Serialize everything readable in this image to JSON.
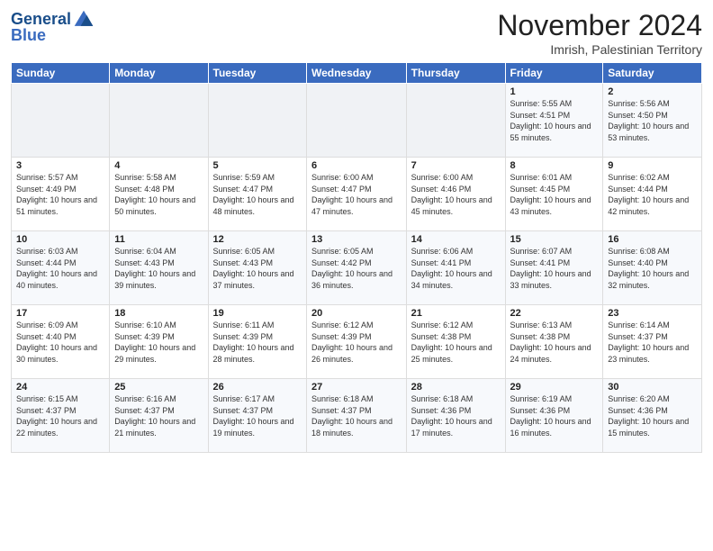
{
  "header": {
    "logo_line1": "General",
    "logo_line2": "Blue",
    "month": "November 2024",
    "location": "Imrish, Palestinian Territory"
  },
  "days_of_week": [
    "Sunday",
    "Monday",
    "Tuesday",
    "Wednesday",
    "Thursday",
    "Friday",
    "Saturday"
  ],
  "weeks": [
    [
      {
        "day": "",
        "info": ""
      },
      {
        "day": "",
        "info": ""
      },
      {
        "day": "",
        "info": ""
      },
      {
        "day": "",
        "info": ""
      },
      {
        "day": "",
        "info": ""
      },
      {
        "day": "1",
        "info": "Sunrise: 5:55 AM\nSunset: 4:51 PM\nDaylight: 10 hours and 55 minutes."
      },
      {
        "day": "2",
        "info": "Sunrise: 5:56 AM\nSunset: 4:50 PM\nDaylight: 10 hours and 53 minutes."
      }
    ],
    [
      {
        "day": "3",
        "info": "Sunrise: 5:57 AM\nSunset: 4:49 PM\nDaylight: 10 hours and 51 minutes."
      },
      {
        "day": "4",
        "info": "Sunrise: 5:58 AM\nSunset: 4:48 PM\nDaylight: 10 hours and 50 minutes."
      },
      {
        "day": "5",
        "info": "Sunrise: 5:59 AM\nSunset: 4:47 PM\nDaylight: 10 hours and 48 minutes."
      },
      {
        "day": "6",
        "info": "Sunrise: 6:00 AM\nSunset: 4:47 PM\nDaylight: 10 hours and 47 minutes."
      },
      {
        "day": "7",
        "info": "Sunrise: 6:00 AM\nSunset: 4:46 PM\nDaylight: 10 hours and 45 minutes."
      },
      {
        "day": "8",
        "info": "Sunrise: 6:01 AM\nSunset: 4:45 PM\nDaylight: 10 hours and 43 minutes."
      },
      {
        "day": "9",
        "info": "Sunrise: 6:02 AM\nSunset: 4:44 PM\nDaylight: 10 hours and 42 minutes."
      }
    ],
    [
      {
        "day": "10",
        "info": "Sunrise: 6:03 AM\nSunset: 4:44 PM\nDaylight: 10 hours and 40 minutes."
      },
      {
        "day": "11",
        "info": "Sunrise: 6:04 AM\nSunset: 4:43 PM\nDaylight: 10 hours and 39 minutes."
      },
      {
        "day": "12",
        "info": "Sunrise: 6:05 AM\nSunset: 4:43 PM\nDaylight: 10 hours and 37 minutes."
      },
      {
        "day": "13",
        "info": "Sunrise: 6:05 AM\nSunset: 4:42 PM\nDaylight: 10 hours and 36 minutes."
      },
      {
        "day": "14",
        "info": "Sunrise: 6:06 AM\nSunset: 4:41 PM\nDaylight: 10 hours and 34 minutes."
      },
      {
        "day": "15",
        "info": "Sunrise: 6:07 AM\nSunset: 4:41 PM\nDaylight: 10 hours and 33 minutes."
      },
      {
        "day": "16",
        "info": "Sunrise: 6:08 AM\nSunset: 4:40 PM\nDaylight: 10 hours and 32 minutes."
      }
    ],
    [
      {
        "day": "17",
        "info": "Sunrise: 6:09 AM\nSunset: 4:40 PM\nDaylight: 10 hours and 30 minutes."
      },
      {
        "day": "18",
        "info": "Sunrise: 6:10 AM\nSunset: 4:39 PM\nDaylight: 10 hours and 29 minutes."
      },
      {
        "day": "19",
        "info": "Sunrise: 6:11 AM\nSunset: 4:39 PM\nDaylight: 10 hours and 28 minutes."
      },
      {
        "day": "20",
        "info": "Sunrise: 6:12 AM\nSunset: 4:39 PM\nDaylight: 10 hours and 26 minutes."
      },
      {
        "day": "21",
        "info": "Sunrise: 6:12 AM\nSunset: 4:38 PM\nDaylight: 10 hours and 25 minutes."
      },
      {
        "day": "22",
        "info": "Sunrise: 6:13 AM\nSunset: 4:38 PM\nDaylight: 10 hours and 24 minutes."
      },
      {
        "day": "23",
        "info": "Sunrise: 6:14 AM\nSunset: 4:37 PM\nDaylight: 10 hours and 23 minutes."
      }
    ],
    [
      {
        "day": "24",
        "info": "Sunrise: 6:15 AM\nSunset: 4:37 PM\nDaylight: 10 hours and 22 minutes."
      },
      {
        "day": "25",
        "info": "Sunrise: 6:16 AM\nSunset: 4:37 PM\nDaylight: 10 hours and 21 minutes."
      },
      {
        "day": "26",
        "info": "Sunrise: 6:17 AM\nSunset: 4:37 PM\nDaylight: 10 hours and 19 minutes."
      },
      {
        "day": "27",
        "info": "Sunrise: 6:18 AM\nSunset: 4:37 PM\nDaylight: 10 hours and 18 minutes."
      },
      {
        "day": "28",
        "info": "Sunrise: 6:18 AM\nSunset: 4:36 PM\nDaylight: 10 hours and 17 minutes."
      },
      {
        "day": "29",
        "info": "Sunrise: 6:19 AM\nSunset: 4:36 PM\nDaylight: 10 hours and 16 minutes."
      },
      {
        "day": "30",
        "info": "Sunrise: 6:20 AM\nSunset: 4:36 PM\nDaylight: 10 hours and 15 minutes."
      }
    ]
  ]
}
